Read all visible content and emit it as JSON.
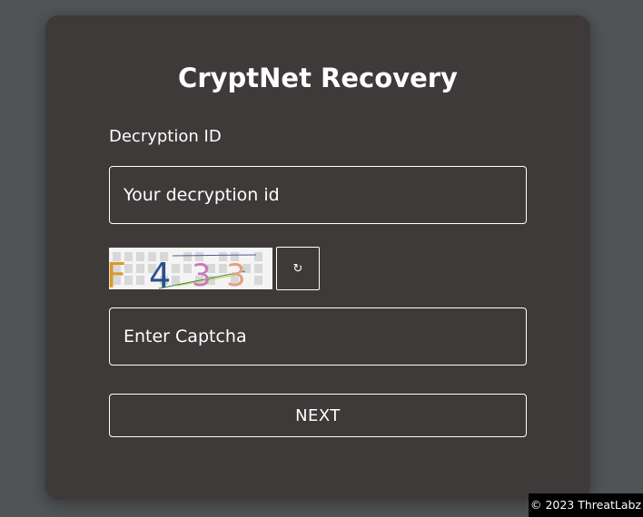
{
  "card": {
    "title": "CryptNet Recovery",
    "decryption_label": "Decryption ID",
    "decryption_placeholder": "Your decryption id",
    "captcha_text": "F433",
    "refresh_icon": "↻",
    "captcha_placeholder": "Enter Captcha",
    "next_label": "NEXT"
  },
  "watermark": "© 2023 ThreatLabz",
  "colors": {
    "page_background": "#515456",
    "card_background": "#3d3a39",
    "text": "#ffffff"
  }
}
